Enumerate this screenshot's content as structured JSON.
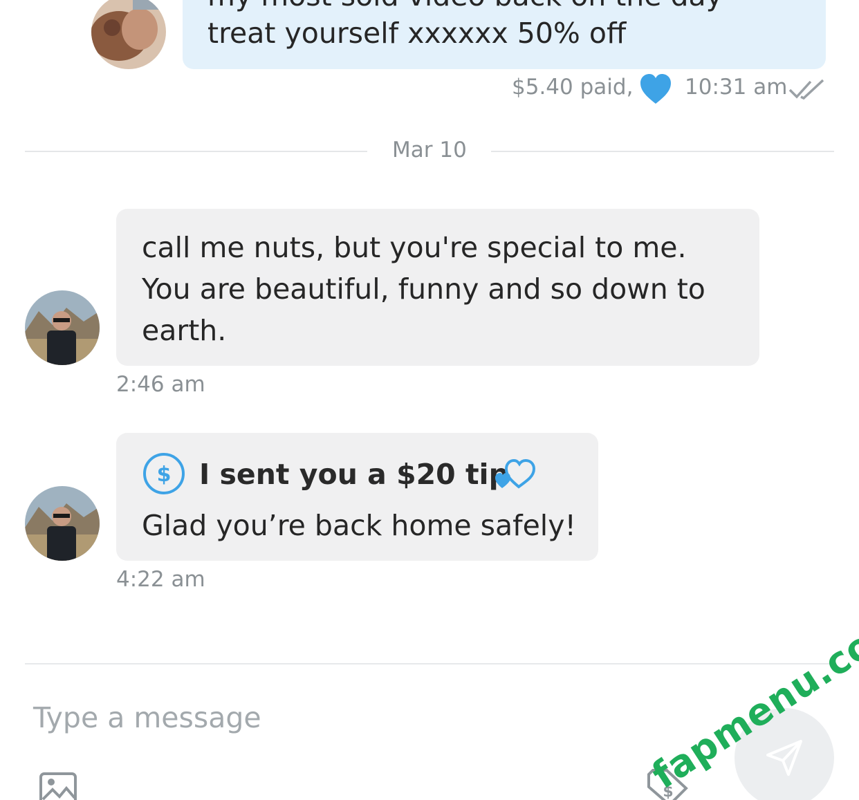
{
  "messages": {
    "outgoing_promo": {
      "line1": "my most sold video back on the day",
      "line2": "treat yourself xxxxxx 50% off",
      "paid": "$5.40 paid,",
      "time": "10:31 am"
    },
    "date_divider": "Mar 10",
    "incoming_1": {
      "line1": "call me nuts, but you're special to me.",
      "line2": "You are beautiful, funny and so down to",
      "line3": "earth.",
      "time": "2:46 am"
    },
    "incoming_tip": {
      "tip_title": "I sent you a $20 tip",
      "body": "Glad you’re back home safely!",
      "time": "4:22 am"
    }
  },
  "composer": {
    "placeholder": "Type a message"
  },
  "watermark": "fapmenu.com",
  "icons": {
    "like": "heart-icon",
    "read_receipt": "double-check-icon",
    "tip": "dollar-circle-icon",
    "tip_hearts": "hearts-icon",
    "media": "image-icon",
    "price": "price-tag-icon",
    "send": "send-icon"
  },
  "colors": {
    "outgoing_bubble": "#e3f1fb",
    "incoming_bubble": "#f0f0f1",
    "accent_blue": "#3ea3e6",
    "watermark_green": "#1fae5a"
  }
}
